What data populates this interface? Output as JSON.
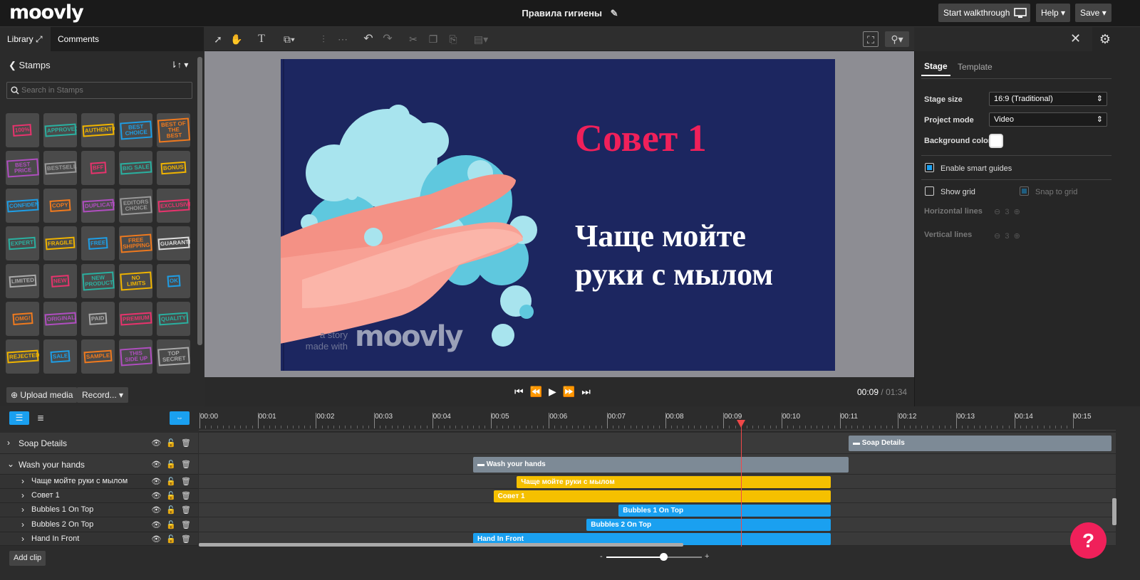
{
  "app": {
    "logo": "moovly",
    "project_title": "Правила гигиены"
  },
  "topbar": {
    "walkthrough_label": "Start walkthrough",
    "help_label": "Help",
    "save_label": "Save"
  },
  "left_panel": {
    "tabs": [
      {
        "label": "Library"
      },
      {
        "label": "Comments"
      }
    ],
    "section_title": "Stamps",
    "search_placeholder": "Search in Stamps",
    "stamps": [
      {
        "label": "100%",
        "color": "#e8336d"
      },
      {
        "label": "APPROVED",
        "color": "#2ab0a0"
      },
      {
        "label": "AUTHENTIC",
        "color": "#f0b400"
      },
      {
        "label": "BEST CHOICE",
        "color": "#1e9ee6"
      },
      {
        "label": "BEST OF THE BEST",
        "color": "#f07a1e"
      },
      {
        "label": "BEST PRICE",
        "color": "#b04ec0"
      },
      {
        "label": "BESTSELLER",
        "color": "#999999"
      },
      {
        "label": "BFF",
        "color": "#e8336d"
      },
      {
        "label": "BIG SALE",
        "color": "#2ab0a0"
      },
      {
        "label": "BONUS",
        "color": "#f0b400"
      },
      {
        "label": "CONFIDENTIAL",
        "color": "#1e9ee6"
      },
      {
        "label": "COPY",
        "color": "#f07a1e"
      },
      {
        "label": "DUPLICATE",
        "color": "#b04ec0"
      },
      {
        "label": "EDITORS CHOICE",
        "color": "#999999"
      },
      {
        "label": "EXCLUSIVE",
        "color": "#e8336d"
      },
      {
        "label": "EXPERT",
        "color": "#2ab0a0"
      },
      {
        "label": "FRAGILE",
        "color": "#f0b400"
      },
      {
        "label": "FREE",
        "color": "#1e9ee6"
      },
      {
        "label": "FREE SHIPPING",
        "color": "#f07a1e"
      },
      {
        "label": "GUARANTEED",
        "color": "#dddddd"
      },
      {
        "label": "LIMITED",
        "color": "#aaaaaa"
      },
      {
        "label": "NEW",
        "color": "#e8336d"
      },
      {
        "label": "NEW PRODUCT",
        "color": "#2ab0a0"
      },
      {
        "label": "NO LIMITS",
        "color": "#f0b400"
      },
      {
        "label": "OK",
        "color": "#1e9ee6"
      },
      {
        "label": "OMG!",
        "color": "#f07a1e"
      },
      {
        "label": "ORIGINAL",
        "color": "#b04ec0"
      },
      {
        "label": "PAID",
        "color": "#aaaaaa"
      },
      {
        "label": "PREMIUM",
        "color": "#e8336d"
      },
      {
        "label": "QUALITY",
        "color": "#2ab0a0"
      },
      {
        "label": "REJECTED",
        "color": "#f0b400"
      },
      {
        "label": "SALE",
        "color": "#1e9ee6"
      },
      {
        "label": "SAMPLE",
        "color": "#f07a1e"
      },
      {
        "label": "THIS SIDE UP",
        "color": "#b04ec0"
      },
      {
        "label": "TOP SECRET",
        "color": "#aaaaaa"
      }
    ],
    "upload_label": "Upload media",
    "record_label": "Record..."
  },
  "stage": {
    "heading": "Совет 1",
    "heading_color": "#f0205a",
    "body_line1": "Чаще мойте",
    "body_line2": "руки с мылом",
    "watermark_small": "a story",
    "watermark_small2": "made with",
    "watermark_logo": "moovly",
    "bg_color": "#1c2660"
  },
  "player": {
    "current_time": "00:09",
    "separator": "/",
    "total_time": "01:34"
  },
  "right_panel": {
    "tabs": [
      {
        "label": "Stage"
      },
      {
        "label": "Template"
      }
    ],
    "stage_size_label": "Stage size",
    "stage_size_value": "16:9 (Traditional)",
    "project_mode_label": "Project mode",
    "project_mode_value": "Video",
    "bg_color_label": "Background color",
    "smart_guides_label": "Enable smart guides",
    "smart_guides_checked": true,
    "show_grid_label": "Show grid",
    "snap_grid_label": "Snap to grid",
    "horizontal_lines_label": "Horizontal lines",
    "horizontal_lines_value": "3",
    "vertical_lines_label": "Vertical lines",
    "vertical_lines_value": "3"
  },
  "timeline": {
    "ticks": [
      "00:00",
      "00:01",
      "00:02",
      "00:03",
      "00:04",
      "00:05",
      "00:06",
      "00:07",
      "00:08",
      "00:09",
      "00:10",
      "00:11",
      "00:12",
      "00:13",
      "00:14",
      "00:15"
    ],
    "playhead_seconds": 9.3,
    "layers": [
      {
        "name": "Soap Details",
        "expanded": false,
        "indent": 0,
        "clip_label": "Soap Details",
        "clip_start": 11.15,
        "clip_end": 15.8,
        "clip_color": "#7d8a96",
        "folder": true
      },
      {
        "name": "Wash your hands",
        "expanded": true,
        "indent": 0,
        "clip_label": "Wash your hands",
        "clip_start": 4.7,
        "clip_end": 11.15,
        "clip_color": "#7d8a96",
        "folder": true
      },
      {
        "name": "Чаще мойте руки с мылом",
        "expanded": false,
        "indent": 1,
        "clip_label": "Чаще мойте руки с мылом",
        "clip_start": 5.45,
        "clip_end": 10.85,
        "clip_color": "#f5c000",
        "folder": false
      },
      {
        "name": "Совет 1",
        "expanded": false,
        "indent": 1,
        "clip_label": "Совет 1",
        "clip_start": 5.05,
        "clip_end": 10.85,
        "clip_color": "#f5c000",
        "folder": false
      },
      {
        "name": "Bubbles 1 On Top",
        "expanded": false,
        "indent": 1,
        "clip_label": "Bubbles 1 On Top",
        "clip_start": 7.2,
        "clip_end": 10.85,
        "clip_color": "#1aa0f0",
        "folder": false
      },
      {
        "name": "Bubbles 2 On Top",
        "expanded": false,
        "indent": 1,
        "clip_label": "Bubbles 2 On Top",
        "clip_start": 6.65,
        "clip_end": 10.85,
        "clip_color": "#1aa0f0",
        "folder": false
      },
      {
        "name": "Hand In Front",
        "expanded": false,
        "indent": 1,
        "clip_label": "Hand In Front",
        "clip_start": 4.7,
        "clip_end": 10.85,
        "clip_color": "#1aa0f0",
        "folder": false
      }
    ],
    "add_clip_label": "Add clip",
    "zoom_minus": "-",
    "zoom_plus": "+",
    "zoom_level": 0.6,
    "help_bubble": "?"
  }
}
